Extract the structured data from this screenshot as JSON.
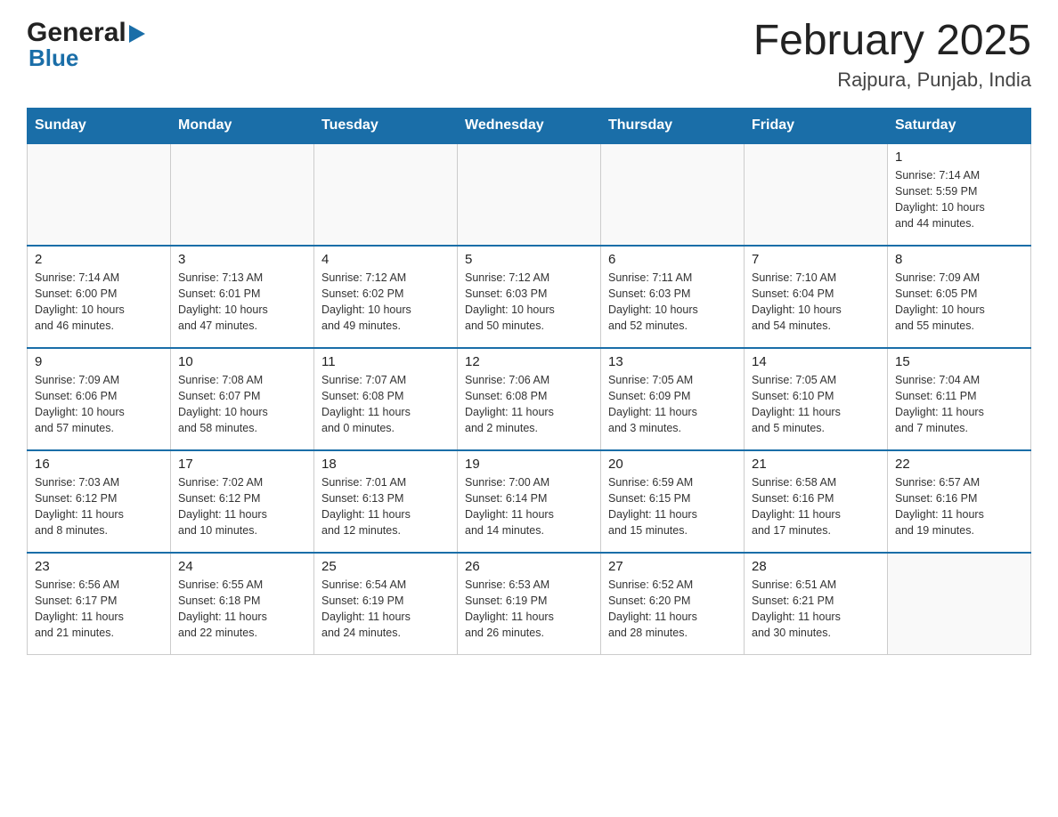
{
  "header": {
    "logo_general": "General",
    "logo_blue": "Blue",
    "month_year": "February 2025",
    "location": "Rajpura, Punjab, India"
  },
  "days_of_week": [
    "Sunday",
    "Monday",
    "Tuesday",
    "Wednesday",
    "Thursday",
    "Friday",
    "Saturday"
  ],
  "weeks": [
    {
      "days": [
        {
          "number": "",
          "info": "",
          "empty": true
        },
        {
          "number": "",
          "info": "",
          "empty": true
        },
        {
          "number": "",
          "info": "",
          "empty": true
        },
        {
          "number": "",
          "info": "",
          "empty": true
        },
        {
          "number": "",
          "info": "",
          "empty": true
        },
        {
          "number": "",
          "info": "",
          "empty": true
        },
        {
          "number": "1",
          "info": "Sunrise: 7:14 AM\nSunset: 5:59 PM\nDaylight: 10 hours\nand 44 minutes.",
          "empty": false
        }
      ]
    },
    {
      "days": [
        {
          "number": "2",
          "info": "Sunrise: 7:14 AM\nSunset: 6:00 PM\nDaylight: 10 hours\nand 46 minutes.",
          "empty": false
        },
        {
          "number": "3",
          "info": "Sunrise: 7:13 AM\nSunset: 6:01 PM\nDaylight: 10 hours\nand 47 minutes.",
          "empty": false
        },
        {
          "number": "4",
          "info": "Sunrise: 7:12 AM\nSunset: 6:02 PM\nDaylight: 10 hours\nand 49 minutes.",
          "empty": false
        },
        {
          "number": "5",
          "info": "Sunrise: 7:12 AM\nSunset: 6:03 PM\nDaylight: 10 hours\nand 50 minutes.",
          "empty": false
        },
        {
          "number": "6",
          "info": "Sunrise: 7:11 AM\nSunset: 6:03 PM\nDaylight: 10 hours\nand 52 minutes.",
          "empty": false
        },
        {
          "number": "7",
          "info": "Sunrise: 7:10 AM\nSunset: 6:04 PM\nDaylight: 10 hours\nand 54 minutes.",
          "empty": false
        },
        {
          "number": "8",
          "info": "Sunrise: 7:09 AM\nSunset: 6:05 PM\nDaylight: 10 hours\nand 55 minutes.",
          "empty": false
        }
      ]
    },
    {
      "days": [
        {
          "number": "9",
          "info": "Sunrise: 7:09 AM\nSunset: 6:06 PM\nDaylight: 10 hours\nand 57 minutes.",
          "empty": false
        },
        {
          "number": "10",
          "info": "Sunrise: 7:08 AM\nSunset: 6:07 PM\nDaylight: 10 hours\nand 58 minutes.",
          "empty": false
        },
        {
          "number": "11",
          "info": "Sunrise: 7:07 AM\nSunset: 6:08 PM\nDaylight: 11 hours\nand 0 minutes.",
          "empty": false
        },
        {
          "number": "12",
          "info": "Sunrise: 7:06 AM\nSunset: 6:08 PM\nDaylight: 11 hours\nand 2 minutes.",
          "empty": false
        },
        {
          "number": "13",
          "info": "Sunrise: 7:05 AM\nSunset: 6:09 PM\nDaylight: 11 hours\nand 3 minutes.",
          "empty": false
        },
        {
          "number": "14",
          "info": "Sunrise: 7:05 AM\nSunset: 6:10 PM\nDaylight: 11 hours\nand 5 minutes.",
          "empty": false
        },
        {
          "number": "15",
          "info": "Sunrise: 7:04 AM\nSunset: 6:11 PM\nDaylight: 11 hours\nand 7 minutes.",
          "empty": false
        }
      ]
    },
    {
      "days": [
        {
          "number": "16",
          "info": "Sunrise: 7:03 AM\nSunset: 6:12 PM\nDaylight: 11 hours\nand 8 minutes.",
          "empty": false
        },
        {
          "number": "17",
          "info": "Sunrise: 7:02 AM\nSunset: 6:12 PM\nDaylight: 11 hours\nand 10 minutes.",
          "empty": false
        },
        {
          "number": "18",
          "info": "Sunrise: 7:01 AM\nSunset: 6:13 PM\nDaylight: 11 hours\nand 12 minutes.",
          "empty": false
        },
        {
          "number": "19",
          "info": "Sunrise: 7:00 AM\nSunset: 6:14 PM\nDaylight: 11 hours\nand 14 minutes.",
          "empty": false
        },
        {
          "number": "20",
          "info": "Sunrise: 6:59 AM\nSunset: 6:15 PM\nDaylight: 11 hours\nand 15 minutes.",
          "empty": false
        },
        {
          "number": "21",
          "info": "Sunrise: 6:58 AM\nSunset: 6:16 PM\nDaylight: 11 hours\nand 17 minutes.",
          "empty": false
        },
        {
          "number": "22",
          "info": "Sunrise: 6:57 AM\nSunset: 6:16 PM\nDaylight: 11 hours\nand 19 minutes.",
          "empty": false
        }
      ]
    },
    {
      "days": [
        {
          "number": "23",
          "info": "Sunrise: 6:56 AM\nSunset: 6:17 PM\nDaylight: 11 hours\nand 21 minutes.",
          "empty": false
        },
        {
          "number": "24",
          "info": "Sunrise: 6:55 AM\nSunset: 6:18 PM\nDaylight: 11 hours\nand 22 minutes.",
          "empty": false
        },
        {
          "number": "25",
          "info": "Sunrise: 6:54 AM\nSunset: 6:19 PM\nDaylight: 11 hours\nand 24 minutes.",
          "empty": false
        },
        {
          "number": "26",
          "info": "Sunrise: 6:53 AM\nSunset: 6:19 PM\nDaylight: 11 hours\nand 26 minutes.",
          "empty": false
        },
        {
          "number": "27",
          "info": "Sunrise: 6:52 AM\nSunset: 6:20 PM\nDaylight: 11 hours\nand 28 minutes.",
          "empty": false
        },
        {
          "number": "28",
          "info": "Sunrise: 6:51 AM\nSunset: 6:21 PM\nDaylight: 11 hours\nand 30 minutes.",
          "empty": false
        },
        {
          "number": "",
          "info": "",
          "empty": true
        }
      ]
    }
  ]
}
